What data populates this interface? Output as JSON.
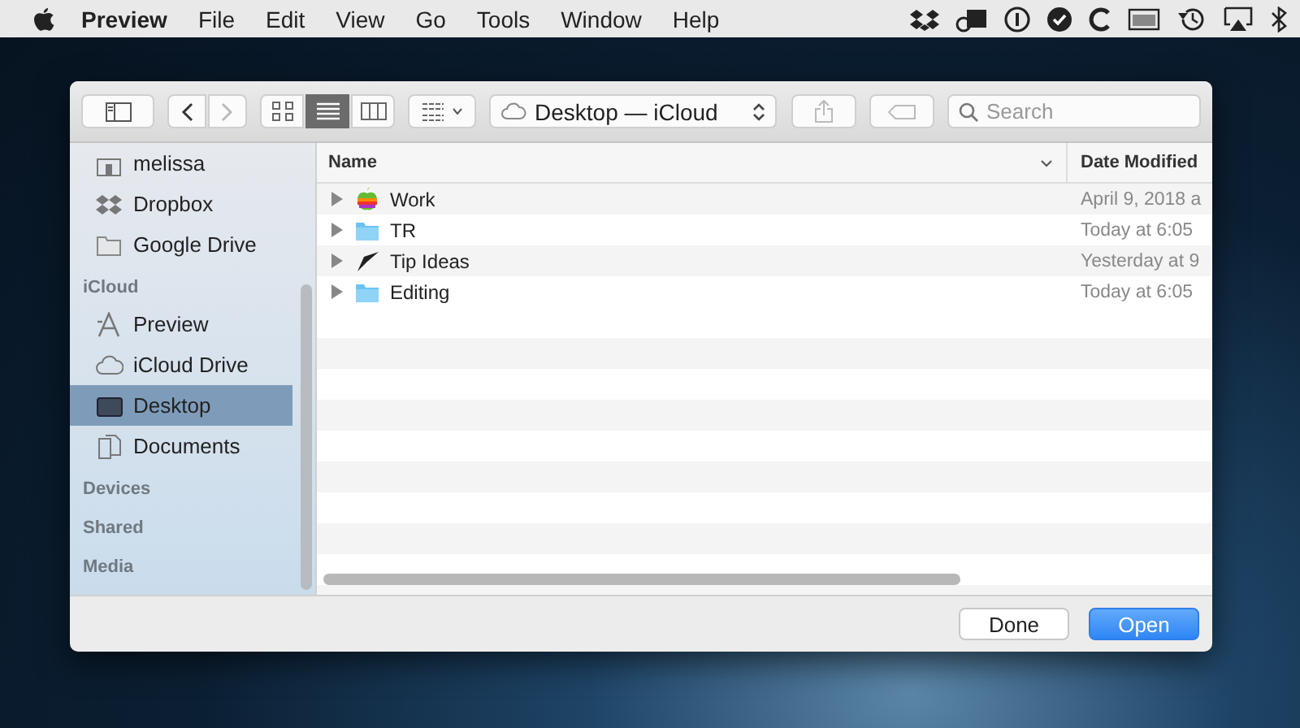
{
  "menubar": {
    "menus": [
      {
        "label": "Preview",
        "kind": "app"
      },
      {
        "label": "File",
        "kind": "menu"
      },
      {
        "label": "Edit",
        "kind": "menu"
      },
      {
        "label": "View",
        "kind": "menu"
      },
      {
        "label": "Go",
        "kind": "menu"
      },
      {
        "label": "Tools",
        "kind": "menu"
      },
      {
        "label": "Window",
        "kind": "menu"
      },
      {
        "label": "Help",
        "kind": "menu"
      }
    ]
  },
  "toolbar": {
    "view_modes": [
      {
        "kind": "icons",
        "selected": false
      },
      {
        "kind": "list",
        "selected": true
      },
      {
        "kind": "columns",
        "selected": false
      }
    ],
    "location": "Desktop — iCloud",
    "search": {
      "placeholder": "Search"
    }
  },
  "sidebar": {
    "sections": [
      {
        "items": [
          {
            "label": "melissa",
            "kind": "home",
            "selected": false
          },
          {
            "label": "Dropbox",
            "kind": "dropbox",
            "selected": false
          },
          {
            "label": "Google Drive",
            "kind": "folder",
            "selected": false
          }
        ]
      },
      {
        "header": "iCloud",
        "items": [
          {
            "label": "Preview",
            "kind": "apps",
            "selected": false
          },
          {
            "label": "iCloud Drive",
            "kind": "cloud",
            "selected": false
          },
          {
            "label": "Desktop",
            "kind": "desktop",
            "selected": true
          },
          {
            "label": "Documents",
            "kind": "documents",
            "selected": false
          }
        ]
      },
      {
        "header": "Devices"
      },
      {
        "header": "Shared"
      },
      {
        "header": "Media"
      }
    ]
  },
  "table": {
    "columns": [
      "Name",
      "Date Modified"
    ],
    "rows": [
      {
        "name": "Work",
        "date": "April 9, 2018 a",
        "kind": "apple",
        "expanded": false
      },
      {
        "name": "TR",
        "date": "Today at 6:05",
        "kind": "folder",
        "expanded": false
      },
      {
        "name": "Tip Ideas",
        "date": "Yesterday at 9",
        "kind": "pen",
        "expanded": false
      },
      {
        "name": "Editing",
        "date": "Today at 6:05",
        "kind": "folder",
        "expanded": false
      }
    ]
  },
  "buttons": [
    {
      "label": "Done",
      "kind": "plain"
    },
    {
      "label": "Open",
      "kind": "primary"
    }
  ]
}
